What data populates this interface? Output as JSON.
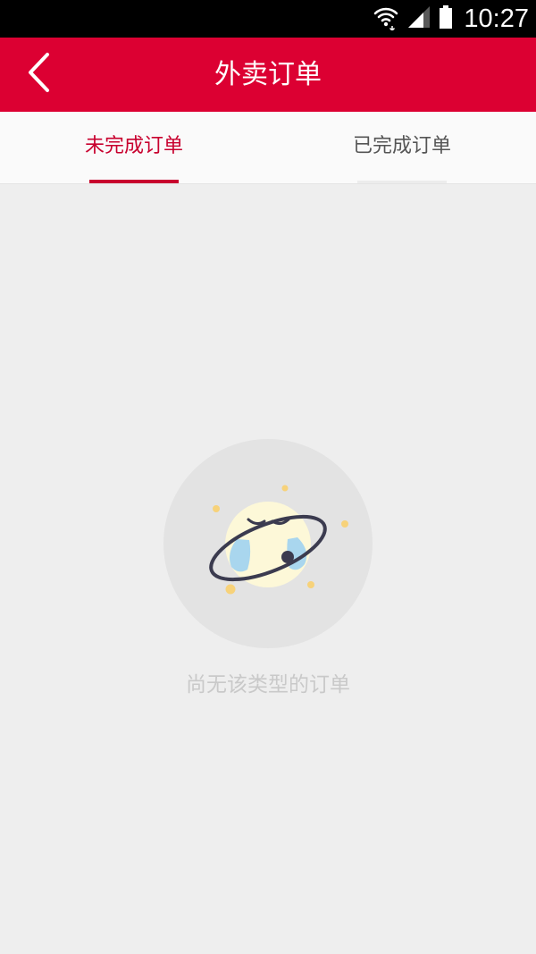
{
  "status_bar": {
    "time": "10:27",
    "icons": [
      "wifi-icon",
      "cell-signal-icon",
      "battery-icon"
    ]
  },
  "header": {
    "title": "外卖订单",
    "back_icon": "chevron-left-icon",
    "background_color": "#dc0032"
  },
  "tabs": [
    {
      "label": "未完成订单",
      "active": true
    },
    {
      "label": "已完成订单",
      "active": false
    }
  ],
  "empty_state": {
    "message": "尚无该类型的订单",
    "illustration": "crying-planet-icon"
  },
  "colors": {
    "accent": "#dc0032",
    "active_tab_text": "#c8002e",
    "background": "#eeeeee"
  }
}
